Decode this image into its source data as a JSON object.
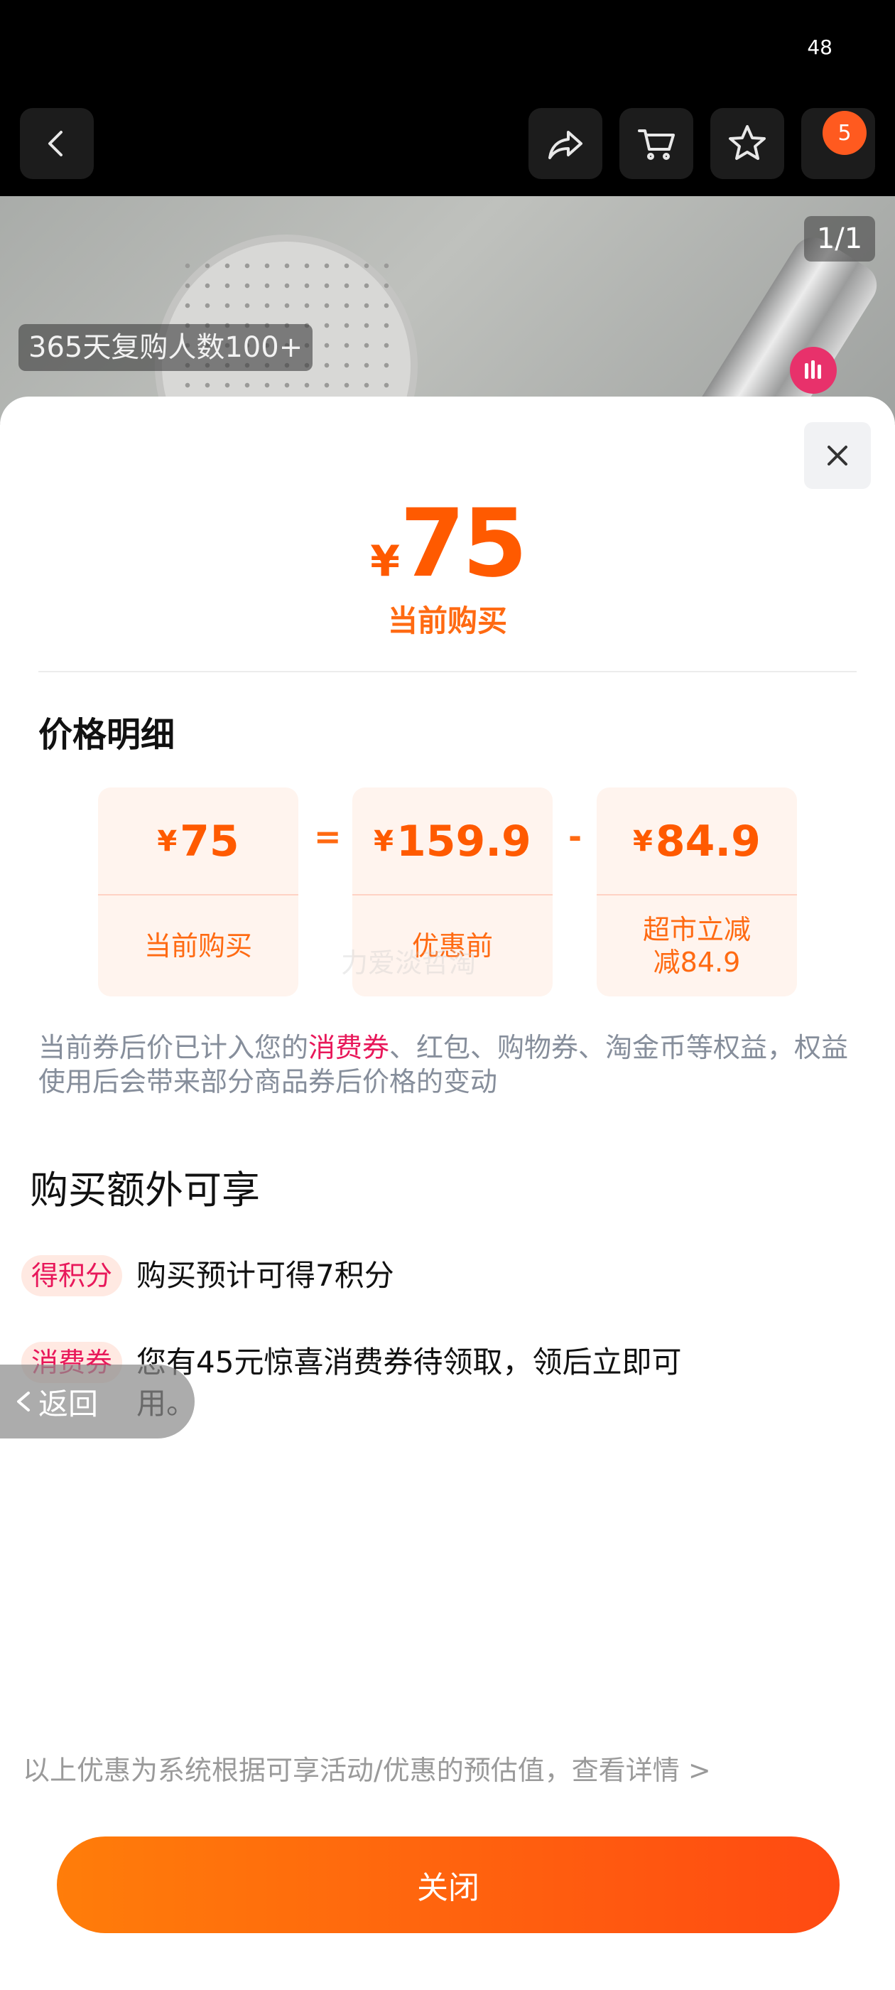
{
  "status_bar": {
    "time": "48"
  },
  "nav": {
    "cart_badge": "5"
  },
  "product": {
    "page_indicator": "1/1",
    "repurchase_label": "365天复购人数100+"
  },
  "sheet": {
    "price_currency": "¥",
    "price_value": "75",
    "price_caption": "当前购买",
    "section_title": "价格明细",
    "breakdown": [
      {
        "currency": "¥",
        "value": "75",
        "label": "当前购买"
      },
      {
        "currency": "¥",
        "value": "159.9",
        "label": "优惠前"
      },
      {
        "currency": "¥",
        "value": "84.9",
        "label": "超市立减\n减84.9"
      }
    ],
    "operators": [
      "=",
      "-"
    ],
    "watermark": "力爱淡哲淘",
    "note_before": "当前券后价已计入您的",
    "note_highlight": "消费券",
    "note_after": "、红包、购物券、淘金币等权益，权益使用后会带来部分商品券后价格的变动",
    "extra_title": "购买额外可享",
    "benefits": [
      {
        "tag": "得积分",
        "text": "购买预计可得7积分"
      },
      {
        "tag": "消费券",
        "text": "您有45元惊喜消费券待领取，领后立即可用。"
      }
    ],
    "back_label": "返回",
    "disclaimer": "以上优惠为系统根据可享活动/优惠的预估值，查看详情 >",
    "close_label": "关闭"
  },
  "colors": {
    "accent": "#ff5a00",
    "highlight": "#e8185a",
    "tag_bg": "#ffe9e2"
  }
}
